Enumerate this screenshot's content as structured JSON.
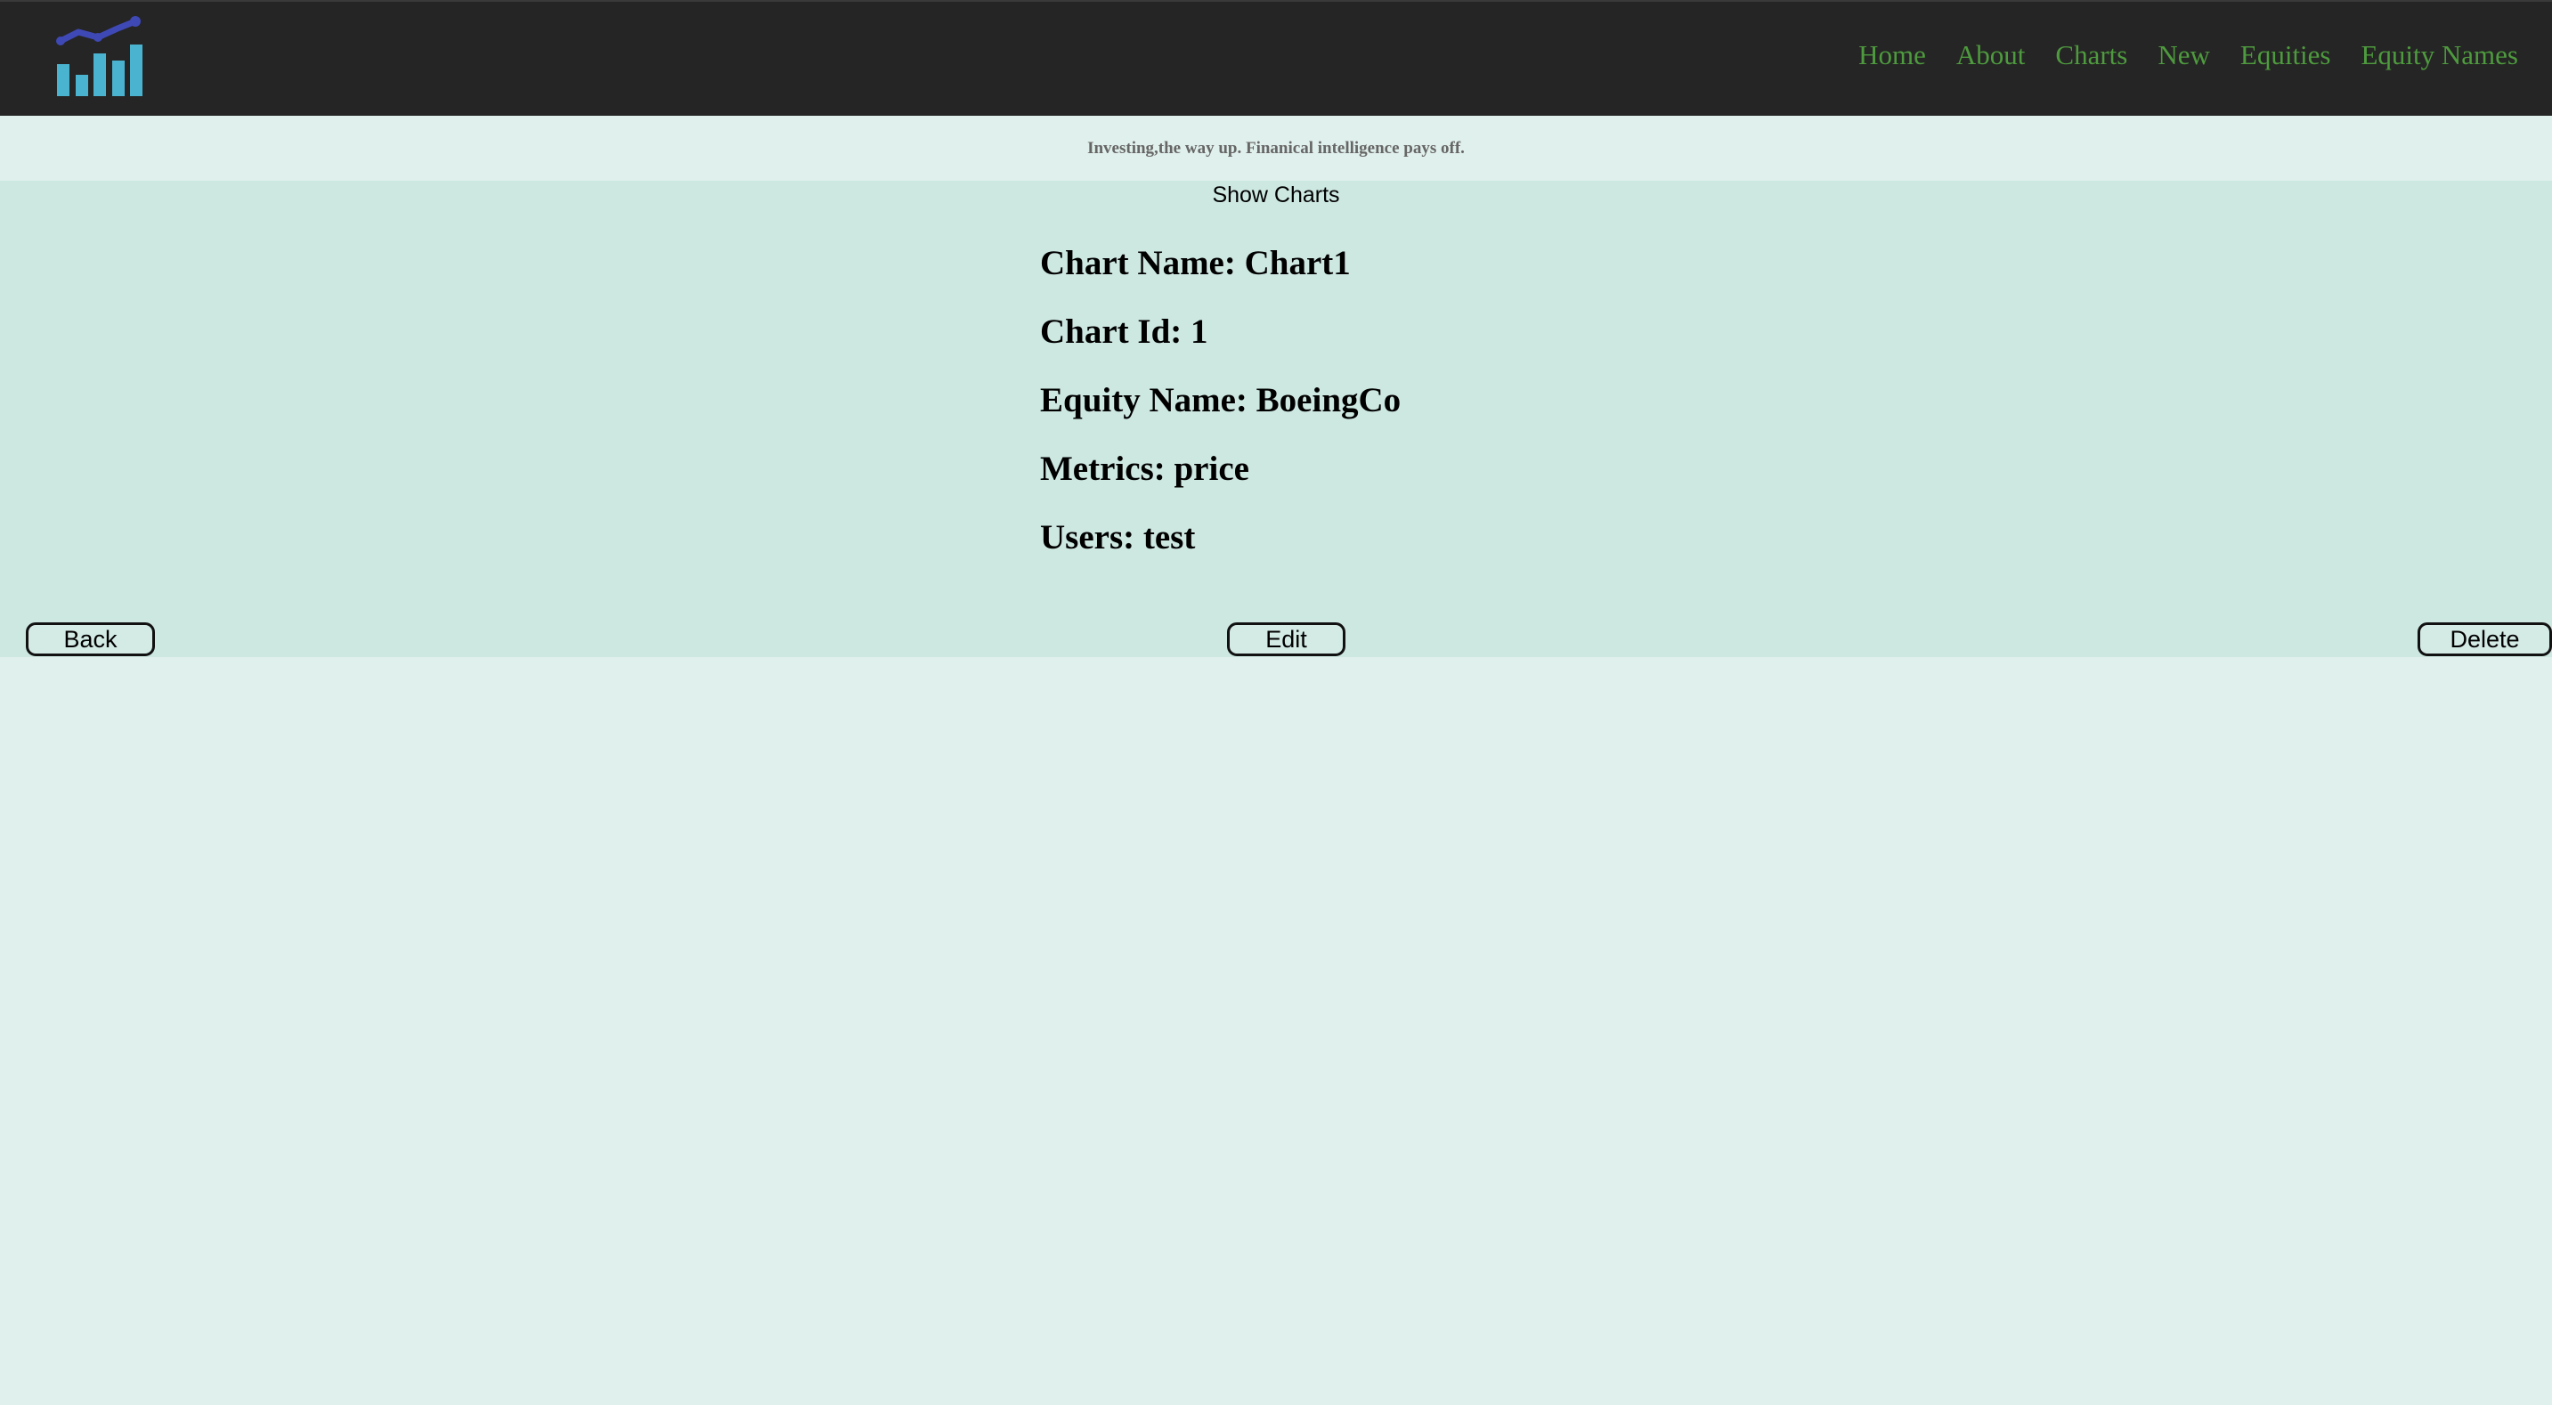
{
  "navbar": {
    "logo_icon": "bar-chart-trend-logo",
    "links": [
      "Home",
      "About",
      "Charts",
      "New",
      "Equities",
      "Equity Names"
    ]
  },
  "tagline": "Investing,the way up. Finanical intelligence pays off.",
  "page": {
    "section_title": "Show Charts",
    "chart_name": "Chart Name: Chart1",
    "chart_id": "Chart Id: 1",
    "equity_name": "Equity Name: BoeingCo",
    "metrics": "Metrics: price",
    "users": "Users: test"
  },
  "buttons": {
    "back": "Back",
    "edit": "Edit",
    "delete": "Delete"
  },
  "colors": {
    "navbar_bg": "#252525",
    "link_green": "#4e9a3e",
    "content_bg": "#cde7e1",
    "page_bg": "#e0f0ec",
    "logo_bars": "#4ab3cf",
    "logo_line": "#3f49b5"
  }
}
